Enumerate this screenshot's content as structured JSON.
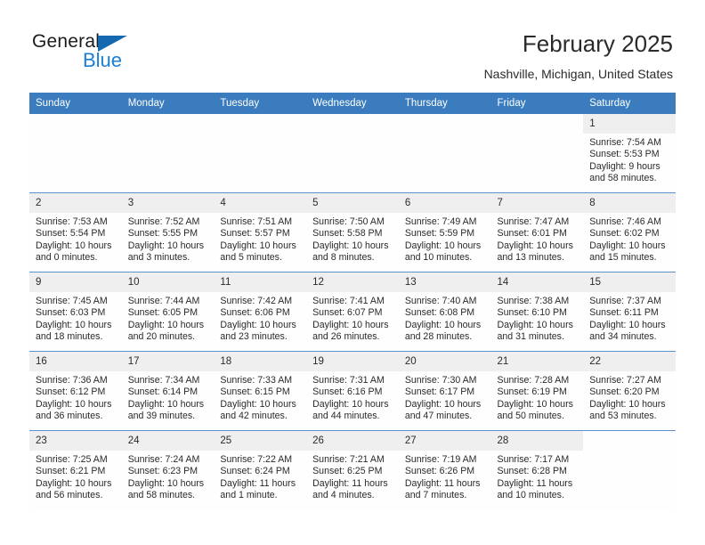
{
  "brand": {
    "name_top": "General",
    "name_bottom": "Blue",
    "accent_color": "#1b7fd4",
    "triangle_color": "#1569b0"
  },
  "header": {
    "title": "February 2025",
    "subtitle": "Nashville, Michigan, United States"
  },
  "theme": {
    "header_bg": "#3a7cbe",
    "daynum_bg": "#efefef",
    "row_divider": "#5a93cc",
    "cell_bg": "#fefefe"
  },
  "weekdays": [
    "Sunday",
    "Monday",
    "Tuesday",
    "Wednesday",
    "Thursday",
    "Friday",
    "Saturday"
  ],
  "weeks": [
    [
      {
        "day": "",
        "info": "",
        "blank": true
      },
      {
        "day": "",
        "info": "",
        "blank": true
      },
      {
        "day": "",
        "info": "",
        "blank": true
      },
      {
        "day": "",
        "info": "",
        "blank": true
      },
      {
        "day": "",
        "info": "",
        "blank": true
      },
      {
        "day": "",
        "info": "",
        "blank": true
      },
      {
        "day": "1",
        "info": "Sunrise: 7:54 AM\nSunset: 5:53 PM\nDaylight: 9 hours\nand 58 minutes."
      }
    ],
    [
      {
        "day": "2",
        "info": "Sunrise: 7:53 AM\nSunset: 5:54 PM\nDaylight: 10 hours\nand 0 minutes."
      },
      {
        "day": "3",
        "info": "Sunrise: 7:52 AM\nSunset: 5:55 PM\nDaylight: 10 hours\nand 3 minutes."
      },
      {
        "day": "4",
        "info": "Sunrise: 7:51 AM\nSunset: 5:57 PM\nDaylight: 10 hours\nand 5 minutes."
      },
      {
        "day": "5",
        "info": "Sunrise: 7:50 AM\nSunset: 5:58 PM\nDaylight: 10 hours\nand 8 minutes."
      },
      {
        "day": "6",
        "info": "Sunrise: 7:49 AM\nSunset: 5:59 PM\nDaylight: 10 hours\nand 10 minutes."
      },
      {
        "day": "7",
        "info": "Sunrise: 7:47 AM\nSunset: 6:01 PM\nDaylight: 10 hours\nand 13 minutes."
      },
      {
        "day": "8",
        "info": "Sunrise: 7:46 AM\nSunset: 6:02 PM\nDaylight: 10 hours\nand 15 minutes."
      }
    ],
    [
      {
        "day": "9",
        "info": "Sunrise: 7:45 AM\nSunset: 6:03 PM\nDaylight: 10 hours\nand 18 minutes."
      },
      {
        "day": "10",
        "info": "Sunrise: 7:44 AM\nSunset: 6:05 PM\nDaylight: 10 hours\nand 20 minutes."
      },
      {
        "day": "11",
        "info": "Sunrise: 7:42 AM\nSunset: 6:06 PM\nDaylight: 10 hours\nand 23 minutes."
      },
      {
        "day": "12",
        "info": "Sunrise: 7:41 AM\nSunset: 6:07 PM\nDaylight: 10 hours\nand 26 minutes."
      },
      {
        "day": "13",
        "info": "Sunrise: 7:40 AM\nSunset: 6:08 PM\nDaylight: 10 hours\nand 28 minutes."
      },
      {
        "day": "14",
        "info": "Sunrise: 7:38 AM\nSunset: 6:10 PM\nDaylight: 10 hours\nand 31 minutes."
      },
      {
        "day": "15",
        "info": "Sunrise: 7:37 AM\nSunset: 6:11 PM\nDaylight: 10 hours\nand 34 minutes."
      }
    ],
    [
      {
        "day": "16",
        "info": "Sunrise: 7:36 AM\nSunset: 6:12 PM\nDaylight: 10 hours\nand 36 minutes."
      },
      {
        "day": "17",
        "info": "Sunrise: 7:34 AM\nSunset: 6:14 PM\nDaylight: 10 hours\nand 39 minutes."
      },
      {
        "day": "18",
        "info": "Sunrise: 7:33 AM\nSunset: 6:15 PM\nDaylight: 10 hours\nand 42 minutes."
      },
      {
        "day": "19",
        "info": "Sunrise: 7:31 AM\nSunset: 6:16 PM\nDaylight: 10 hours\nand 44 minutes."
      },
      {
        "day": "20",
        "info": "Sunrise: 7:30 AM\nSunset: 6:17 PM\nDaylight: 10 hours\nand 47 minutes."
      },
      {
        "day": "21",
        "info": "Sunrise: 7:28 AM\nSunset: 6:19 PM\nDaylight: 10 hours\nand 50 minutes."
      },
      {
        "day": "22",
        "info": "Sunrise: 7:27 AM\nSunset: 6:20 PM\nDaylight: 10 hours\nand 53 minutes."
      }
    ],
    [
      {
        "day": "23",
        "info": "Sunrise: 7:25 AM\nSunset: 6:21 PM\nDaylight: 10 hours\nand 56 minutes."
      },
      {
        "day": "24",
        "info": "Sunrise: 7:24 AM\nSunset: 6:23 PM\nDaylight: 10 hours\nand 58 minutes."
      },
      {
        "day": "25",
        "info": "Sunrise: 7:22 AM\nSunset: 6:24 PM\nDaylight: 11 hours\nand 1 minute."
      },
      {
        "day": "26",
        "info": "Sunrise: 7:21 AM\nSunset: 6:25 PM\nDaylight: 11 hours\nand 4 minutes."
      },
      {
        "day": "27",
        "info": "Sunrise: 7:19 AM\nSunset: 6:26 PM\nDaylight: 11 hours\nand 7 minutes."
      },
      {
        "day": "28",
        "info": "Sunrise: 7:17 AM\nSunset: 6:28 PM\nDaylight: 11 hours\nand 10 minutes."
      },
      {
        "day": "",
        "info": "",
        "blank": true
      }
    ]
  ]
}
